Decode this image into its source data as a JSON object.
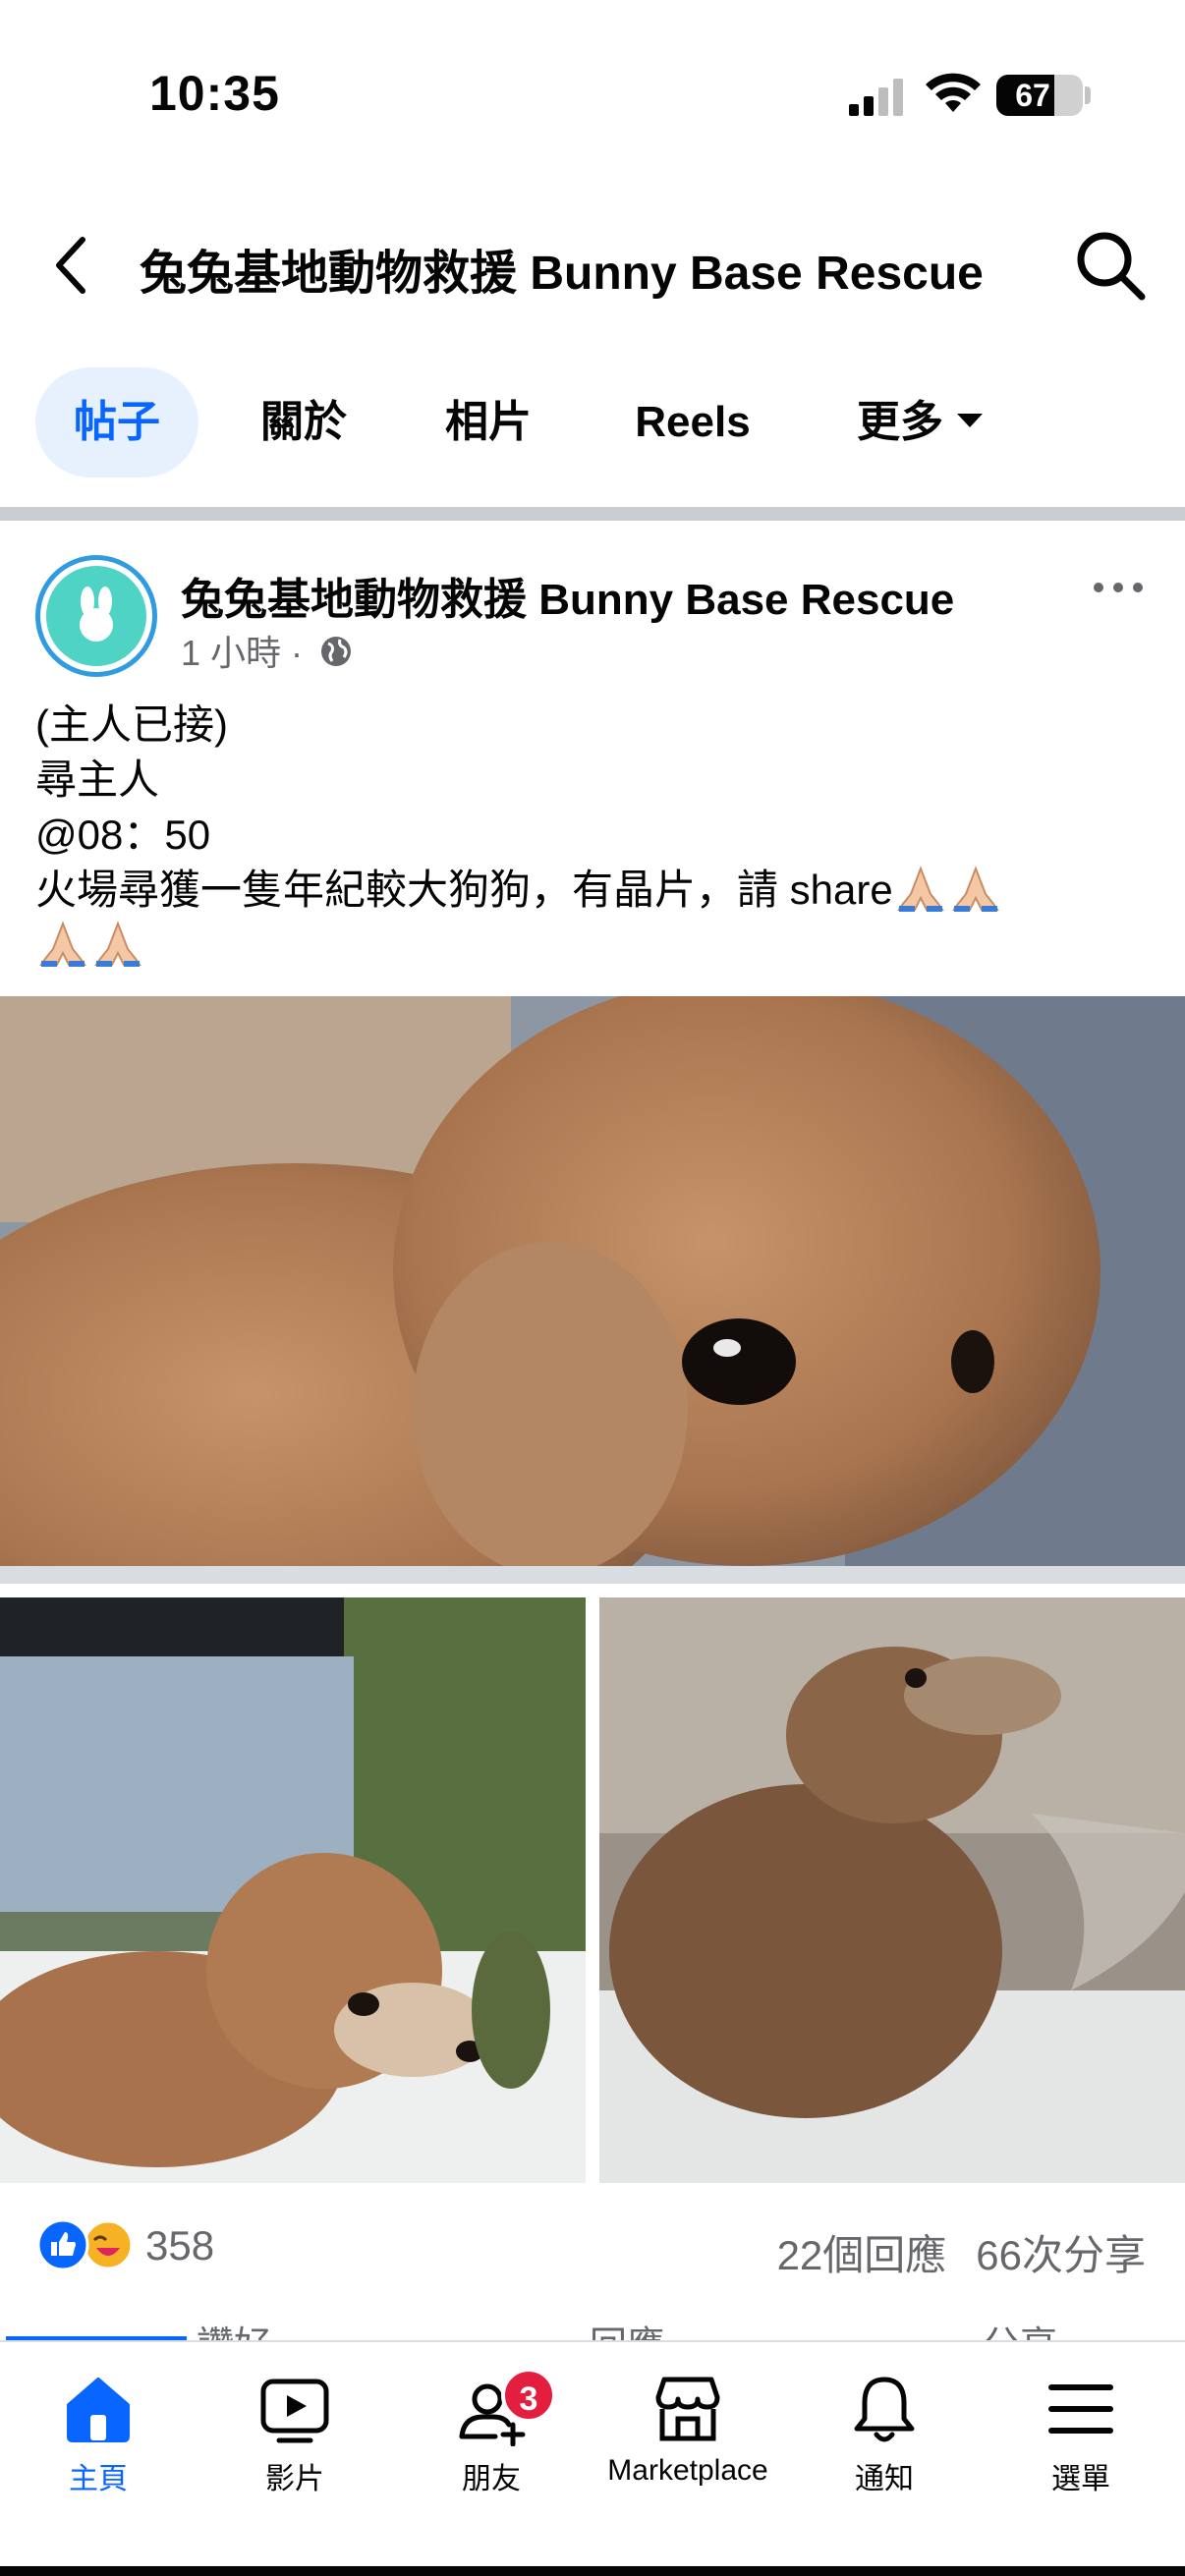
{
  "status_bar": {
    "time": "10:35",
    "battery_level": "67",
    "battery_fraction": 0.67,
    "icons": [
      "cellular-signal-icon",
      "wifi-icon",
      "battery-icon"
    ]
  },
  "header": {
    "title": "兔兔基地動物救援 Bunny Base Rescue",
    "back_icon": "chevron-left-icon",
    "search_icon": "search-icon"
  },
  "tabs": [
    {
      "label": "帖子",
      "active": true
    },
    {
      "label": "關於",
      "active": false
    },
    {
      "label": "相片",
      "active": false
    },
    {
      "label": "Reels",
      "active": false
    },
    {
      "label": "更多",
      "active": false
    }
  ],
  "post": {
    "author": "兔兔基地動物救援 Bunny Base Rescue",
    "time_ago": "1 小時",
    "separator": "·",
    "privacy_icon": "globe-icon",
    "more_icon": "more-horizontal-icon",
    "text_lines": [
      "(主人已接)",
      "尋主人",
      "@08：50",
      "火場尋獲一隻年紀較大狗狗，有晶片，請 share"
    ],
    "emoji": "🙏🏻",
    "photos": [
      "dog-photo-main",
      "dog-photo-left",
      "dog-photo-right"
    ],
    "reaction_count": "358",
    "reaction_icons": [
      "like-reaction-icon",
      "care-reaction-icon"
    ],
    "comments": "22個回應",
    "shares": "66次分享",
    "actions": [
      {
        "label": "讚好"
      },
      {
        "label": "回應"
      },
      {
        "label": "分享"
      }
    ]
  },
  "colors": {
    "accent": "#0866ff",
    "accent_light": "#e7f1fd",
    "text": "#050505",
    "secondary": "#65676b",
    "badge": "#e41e3f"
  },
  "tabbar": [
    {
      "label": "主頁",
      "icon": "home-icon",
      "active": true
    },
    {
      "label": "影片",
      "icon": "video-icon",
      "active": false
    },
    {
      "label": "朋友",
      "icon": "friends-icon",
      "active": false,
      "badge": "3"
    },
    {
      "label": "Marketplace",
      "icon": "marketplace-icon",
      "active": false
    },
    {
      "label": "通知",
      "icon": "bell-icon",
      "active": false
    },
    {
      "label": "選單",
      "icon": "menu-icon",
      "active": false
    }
  ]
}
